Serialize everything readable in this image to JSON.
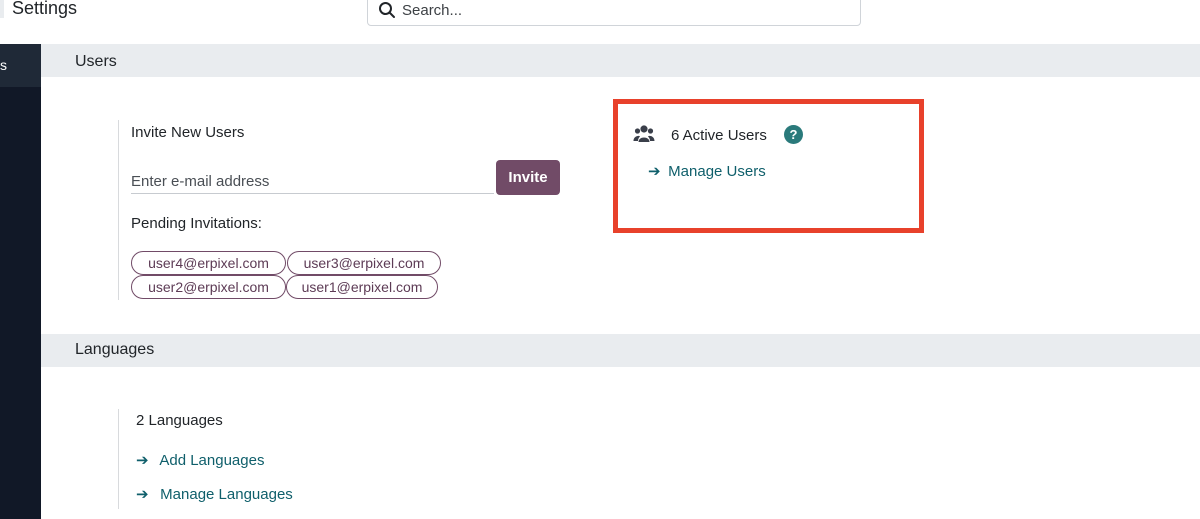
{
  "header": {
    "title": "Settings",
    "search_placeholder": "Search..."
  },
  "sidebar": {
    "items": [
      {
        "label": "s"
      }
    ]
  },
  "users_section": {
    "title": "Users",
    "invite": {
      "label": "Invite New Users",
      "email_placeholder": "Enter e-mail address",
      "button_label": "Invite"
    },
    "pending": {
      "label": "Pending Invitations:",
      "emails": [
        "user4@erpixel.com",
        "user3@erpixel.com",
        "user2@erpixel.com",
        "user1@erpixel.com"
      ]
    },
    "active": {
      "count_label": "6 Active Users",
      "help": "?",
      "manage_link": "Manage Users"
    }
  },
  "languages_section": {
    "title": "Languages",
    "count_label": "2 Languages",
    "add_link": "Add Languages",
    "manage_link": "Manage Languages"
  },
  "colors": {
    "primary": "#714b67",
    "link": "#0f5f6b",
    "highlight": "#e8412b",
    "sidebar": "#111827",
    "section_header": "#e9ecef"
  },
  "icons": {
    "search": "search-icon",
    "users": "users-icon",
    "help": "help-icon",
    "arrow": "arrow-right-icon"
  }
}
